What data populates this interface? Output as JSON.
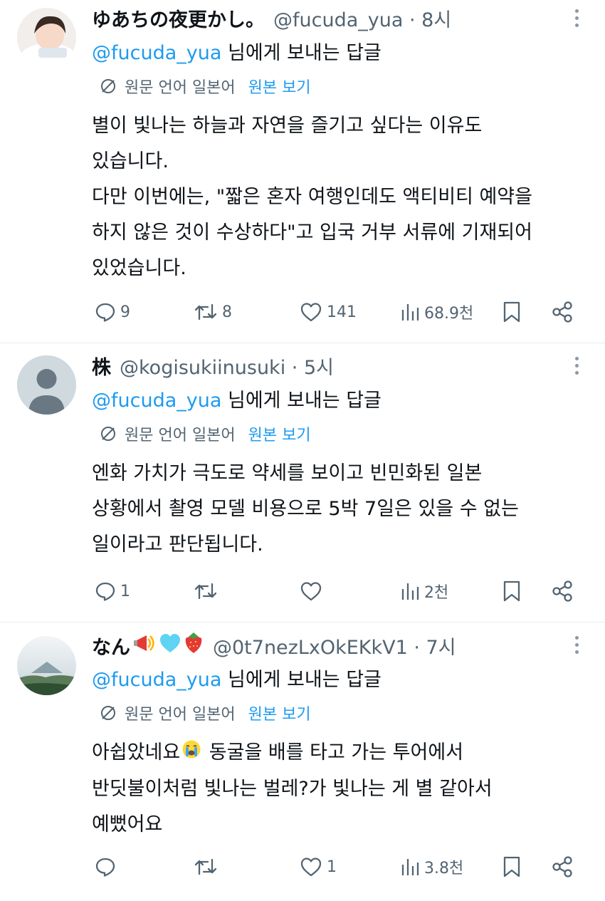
{
  "tweets": [
    {
      "name": "ゆあちの夜更かし。",
      "handle": "@fucuda_yua · 8시",
      "reply_mention": "@fucuda_yua",
      "reply_suffix": " 님에게 보내는 답글",
      "translate_label": "원문 언어 일본어",
      "translate_show": "원본 보기",
      "lines": [
        "별이 빛나는 하늘과 자연을 즐기고 싶다는 이유도",
        "있습니다.",
        "다만 이번에는, \"짧은 혼자 여행인데도 액티비티 예약을",
        "하지 않은 것이 수상하다\"고 입국 거부 서류에 기재되어",
        "있었습니다."
      ],
      "replies": "9",
      "retweets": "8",
      "likes": "141",
      "views": "68.9천"
    },
    {
      "name": "株",
      "handle": "@kogisukiinusuki · 5시",
      "reply_mention": "@fucuda_yua",
      "reply_suffix": " 님에게 보내는 답글",
      "translate_label": "원문 언어 일본어",
      "translate_show": "원본 보기",
      "lines": [
        "엔화 가치가 극도로 약세를 보이고 빈민화된 일본",
        "상황에서 촬영 모델 비용으로 5박 7일은 있을 수 없는",
        "일이라고 판단됩니다."
      ],
      "replies": "1",
      "retweets": "",
      "likes": "",
      "views": "2천"
    },
    {
      "name": "なん",
      "handle": "@0t7nezLxOkEKkV1 · 7시",
      "reply_mention": "@fucuda_yua",
      "reply_suffix": " 님에게 보내는 답글",
      "translate_label": "원문 언어 일본어",
      "translate_show": "원본 보기",
      "line1_a": "아쉽았네요",
      "line1_b": " 동굴을 배를 타고 가는 투어에서",
      "lines": [
        "반딧불이처럼 빛나는 벌레?가 빛나는 게 별 같아서",
        "예뻤어요"
      ],
      "replies": "",
      "retweets": "",
      "likes": "1",
      "views": "3.8천"
    }
  ],
  "colors": {
    "accent": "#1d9bf0",
    "muted": "#536471",
    "text": "#0f1419",
    "divider": "#e6ecf0"
  }
}
